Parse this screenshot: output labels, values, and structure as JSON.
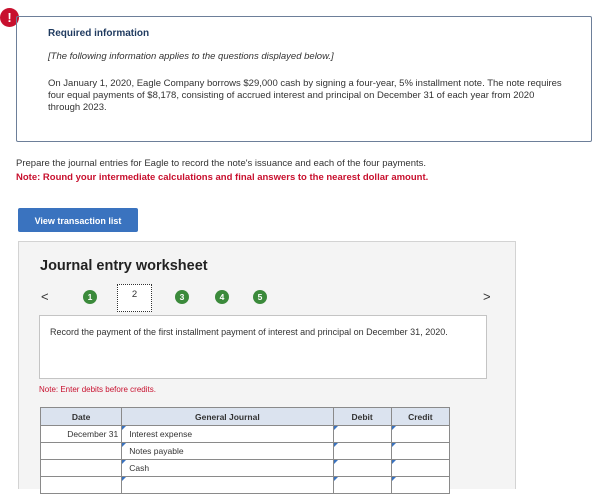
{
  "alert": {
    "icon": "exclamation-icon",
    "symbol": "!"
  },
  "required": {
    "title": "Required information",
    "italic": "[The following information applies to the questions displayed below.]",
    "body": "On January 1, 2020, Eagle Company borrows $29,000 cash by signing a four-year, 5% installment note. The note requires four equal payments of $8,178, consisting of accrued interest and principal on December 31 of each year from 2020 through 2023."
  },
  "prepare_text": "Prepare the journal entries for Eagle to record the note's issuance and each of the four payments.",
  "note_text": "Note: Round your intermediate calculations and final answers to the nearest dollar amount.",
  "view_button": "View transaction list",
  "worksheet": {
    "title": "Journal entry worksheet",
    "nav_prev": "<",
    "nav_next": ">",
    "steps": [
      "1",
      "2",
      "3",
      "4",
      "5"
    ],
    "current_step": "2",
    "instruction": "Record the payment of the first installment payment of interest and principal on December 31, 2020.",
    "debit_note": "Note: Enter debits before credits.",
    "table": {
      "headers": {
        "date": "Date",
        "journal": "General Journal",
        "debit": "Debit",
        "credit": "Credit"
      },
      "rows": [
        {
          "date": "December 31",
          "account": "Interest expense",
          "debit": "",
          "credit": ""
        },
        {
          "date": "",
          "account": "Notes payable",
          "debit": "",
          "credit": ""
        },
        {
          "date": "",
          "account": "Cash",
          "debit": "",
          "credit": ""
        },
        {
          "date": "",
          "account": "",
          "debit": "",
          "credit": ""
        }
      ]
    }
  },
  "colors": {
    "accent": "#3a73bf",
    "alert_red": "#c8102e",
    "step_green": "#3b8a3b",
    "header_blue": "#dbe3ef"
  }
}
